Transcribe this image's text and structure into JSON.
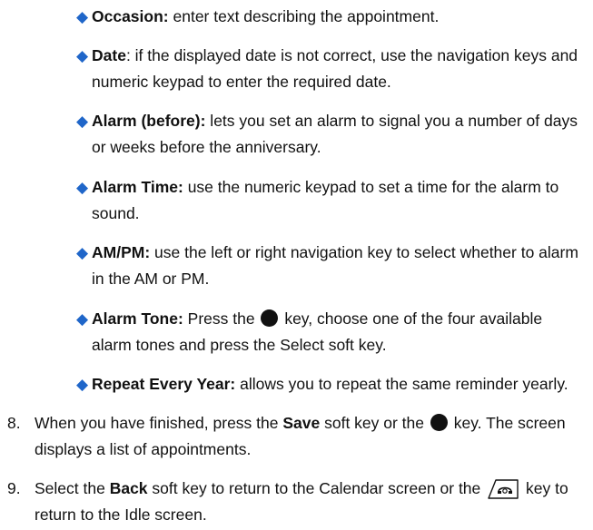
{
  "bullets": [
    {
      "label": "Occasion:",
      "text": " enter text describing the appointment."
    },
    {
      "label": "Date",
      "text": ": if the displayed date is not correct, use the navigation keys and numeric keypad to enter the required date."
    },
    {
      "label": "Alarm (before):",
      "text": " lets you set an alarm to signal you a number of days or weeks before the anniversary."
    },
    {
      "label": "Alarm Time:",
      "text": " use the numeric keypad to set a time for the alarm to sound."
    },
    {
      "label": "AM/PM:",
      "text": " use the left or right navigation key to select whether to alarm in the AM or PM."
    },
    {
      "label": "Alarm Tone:",
      "text_before_icon": " Press the ",
      "text_after_icon": " key, choose one of the four available alarm tones and press the Select soft key."
    },
    {
      "label": "Repeat Every Year:",
      "text": " allows you to repeat the same reminder yearly."
    }
  ],
  "steps": [
    {
      "number": "8.",
      "t1": "When you have finished, press the ",
      "bold": "Save",
      "t2": " soft key or the ",
      "t3": " key. The screen displays a list of appointments."
    },
    {
      "number": "9.",
      "t1": "Select the ",
      "bold": "Back",
      "t2": " soft key to return to the Calendar screen or the ",
      "t3": " key to return to the Idle screen."
    }
  ],
  "colors": {
    "bullet": "#1f66c9",
    "text": "#111111"
  },
  "icons": {
    "bullet": "diamond-bullet-icon",
    "select_key": "round-key-icon",
    "end_key": "end-key-icon"
  }
}
